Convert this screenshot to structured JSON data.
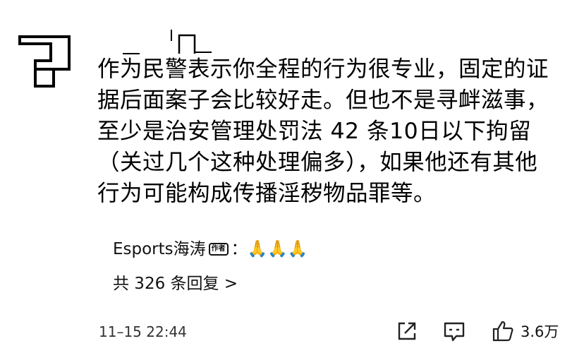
{
  "comment": {
    "lines": [
      "作为民警表示你全程的行为很专业，固定的证",
      "据后面案子会比较好走。但也不是寻衅滋事，",
      "至少是治安管理处罚法 42 条10日以下拘留",
      "（关过几个这种处理偏多），如果他还有其他",
      "行为可能构成传播淫秽物品罪等。"
    ]
  },
  "reply_preview": {
    "author": "Esports海涛",
    "badge": "作者",
    "separator": "：",
    "content": "🙏🙏🙏"
  },
  "reply_count": "共 326 条回复 >",
  "footer": {
    "timestamp": "11–15 22:44",
    "likes": "3.6万"
  },
  "icons": [
    "share-icon",
    "comment-icon",
    "thumbs-up-icon"
  ]
}
